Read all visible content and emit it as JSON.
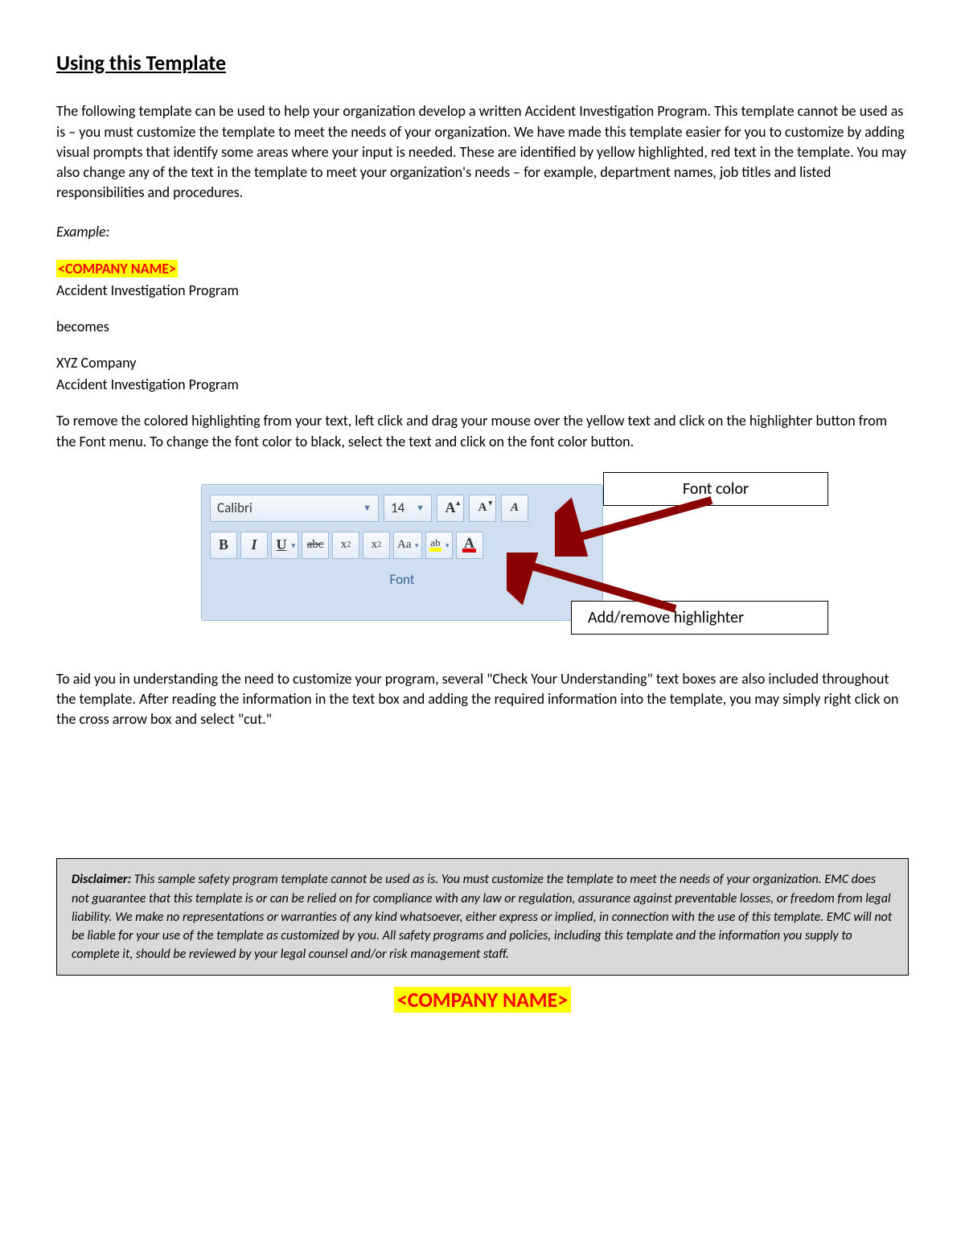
{
  "heading": "Using this Template",
  "intro": "The following template can be used to help your organization develop a written Accident Investigation Program. This template cannot be used as is – you must customize the template to meet the needs of your organization. We have made this template easier for you to customize by adding visual prompts that identify some areas where your input is needed. These are identified by yellow highlighted, red text in the template. You may also change any of the text in the template to meet your organization's needs – for example, department names, job titles and listed responsibilities and procedures.",
  "example_label": "Example:",
  "company_placeholder": "<COMPANY NAME>",
  "program_name": "Accident Investigation Program",
  "becomes": "becomes",
  "xyz": "XYZ Company",
  "instructions2": "To remove the colored highlighting from your text, left click and drag your mouse over the yellow text and click on the highlighter button from the Font menu. To change the font color to black, select the text and click on the font color button.",
  "ribbon": {
    "font_name": "Calibri",
    "font_size": "14",
    "group_label": "Font",
    "bold": "B",
    "italic": "I",
    "underline": "U",
    "strike": "abc",
    "subscript": "x",
    "subscript_sub": "2",
    "superscript": "x",
    "superscript_sup": "2",
    "changecase": "Aa",
    "highlight_label": "ab",
    "fontcolor_A": "A",
    "grow_A": "A",
    "grow_sup": "▴",
    "shrink_A": "A",
    "shrink_sup": "▾",
    "clear": "A"
  },
  "callout_fontcolor": "Font color",
  "callout_highlighter": "Add/remove highlighter",
  "instructions3": "To aid you in understanding the need to customize your program, several \"Check Your Understanding\" text boxes are also included throughout the template. After reading the information in the text box and adding the required information into the template, you may simply right click on the cross arrow box and select \"cut.\"",
  "disclaimer_label": "Disclaimer:",
  "disclaimer_text": " This sample safety program template cannot be used as is. You must customize the template to meet the needs of your organization.  EMC does not guarantee that this template is or can be relied on for compliance with any law or regulation, assurance against preventable losses, or freedom from legal liability. We make no representations or warranties of any kind whatsoever, either express or implied, in connection with the use of this template. EMC will not be liable for your use of the template as customized by you.  All safety programs and policies, including this template and the information you supply to complete it, should be reviewed by your legal counsel and/or risk management staff.",
  "footer_placeholder": "<COMPANY NAME>"
}
